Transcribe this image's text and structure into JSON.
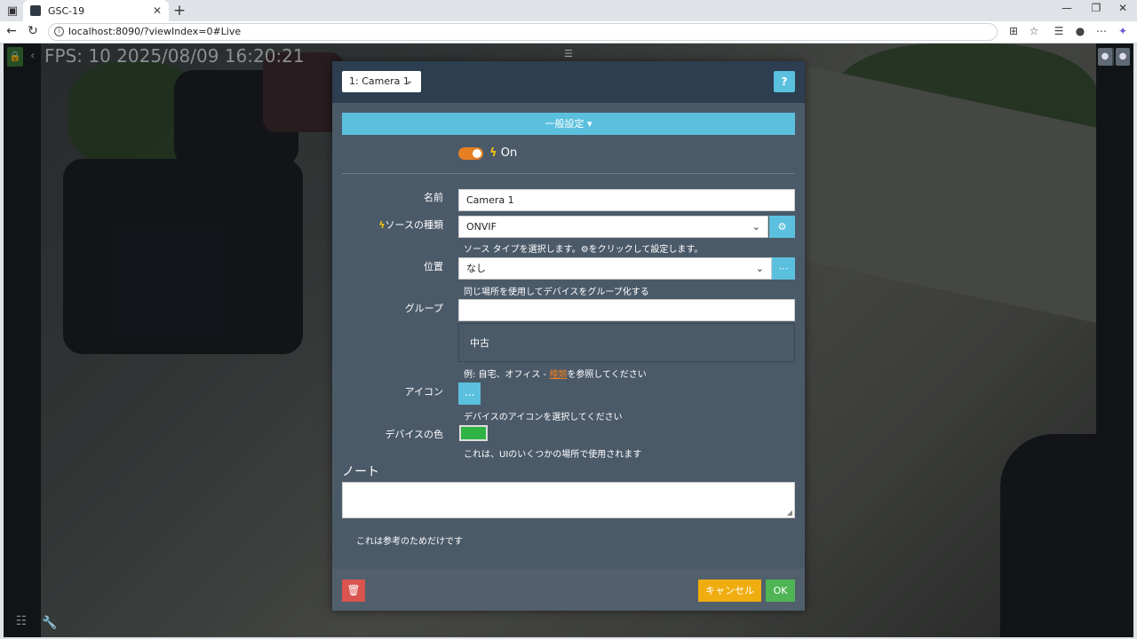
{
  "browser": {
    "tab_title": "GSC-19",
    "url": "localhost:8090/?viewIndex=0#Live"
  },
  "viewer": {
    "osd_text": "FPS: 10 2025/08/09 16:20:21"
  },
  "modal": {
    "camera_select": "1: Camera 1",
    "help_label": "?",
    "section_title": "一般設定",
    "toggle_label": "On",
    "fields": {
      "name_label": "名前",
      "name_value": "Camera 1",
      "source_label": "ソースの種類",
      "source_value": "ONVIF",
      "source_hint_before": "ソース タイプを選択します。",
      "source_hint_after": "をクリックして設定します。",
      "location_label": "位置",
      "location_value": "なし",
      "location_hint": "同じ場所を使用してデバイスをグループ化する",
      "group_label": "グループ",
      "group_value": "",
      "group_option": "中古",
      "group_hint_before": "例: 自宅、オフィス - ",
      "group_hint_link": "種類",
      "group_hint_after": "を参照してください",
      "icon_label": "アイコン",
      "icon_button": "...",
      "icon_hint": "デバイスのアイコンを選択してください",
      "color_label": "デバイスの色",
      "color_value": "#2fb344",
      "color_hint": "これは、UIのいくつかの場所で使用されます"
    },
    "note_title": "ノート",
    "note_value": "",
    "reference_text": "これは参考のためだけです",
    "cancel_label": "キャンセル",
    "ok_label": "OK"
  },
  "colors": {
    "info": "#5bc0de",
    "warning": "#f0ad10",
    "success": "#4fb454",
    "danger": "#d9534f",
    "header": "#2c3e50",
    "body": "#4b5a69"
  }
}
